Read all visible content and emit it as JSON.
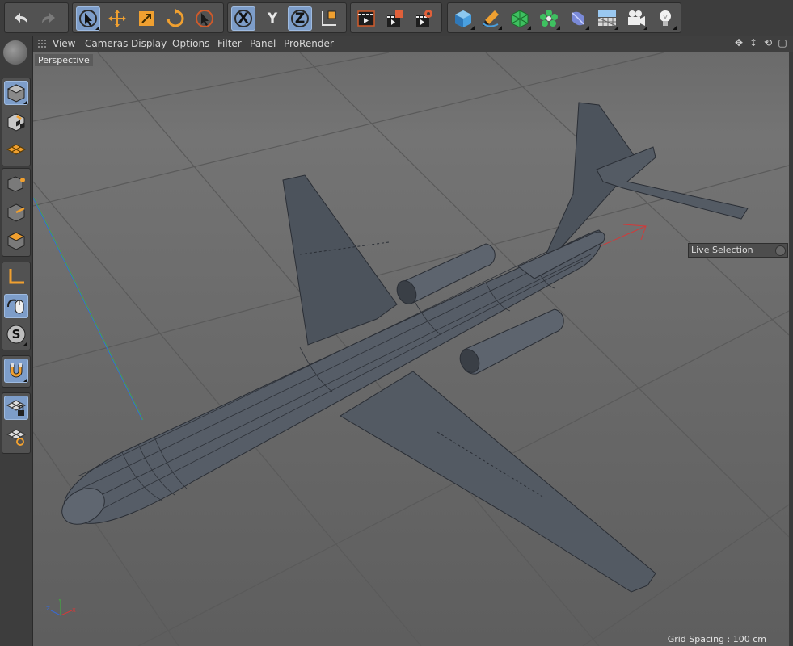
{
  "toolbar": {
    "groups": [
      {
        "name": "history",
        "buttons": [
          "undo-icon",
          "redo-icon"
        ]
      },
      {
        "name": "tools",
        "buttons": [
          "live-selection-icon",
          "move-icon",
          "scale-icon",
          "rotate-icon",
          "last-tool-icon"
        ]
      },
      {
        "name": "axis-lock",
        "buttons": [
          "x-axis-icon",
          "y-axis-icon",
          "z-axis-icon",
          "coordinate-system-icon"
        ]
      },
      {
        "name": "render",
        "buttons": [
          "render-view-icon",
          "render-picture-viewer-icon",
          "render-settings-icon"
        ]
      },
      {
        "name": "create",
        "buttons": [
          "cube-icon",
          "pen-spline-icon",
          "subdivision-icon",
          "cloner-icon",
          "deformer-icon",
          "floor-icon",
          "camera-icon",
          "light-icon"
        ]
      }
    ],
    "axis_labels": {
      "x": "X",
      "y": "Y",
      "z": "Z"
    }
  },
  "leftbar": {
    "groups": [
      {
        "name": "mode",
        "buttons": [
          "model-mode-icon",
          "texture-mode-icon",
          "workplane-mode-icon"
        ]
      },
      {
        "name": "components",
        "buttons": [
          "points-mode-icon",
          "edges-mode-icon",
          "polygons-mode-icon"
        ]
      },
      {
        "name": "axis",
        "buttons": [
          "enable-axis-icon",
          "tweak-mode-icon",
          "solo-icon"
        ]
      },
      {
        "name": "snap",
        "buttons": [
          "snap-icon"
        ]
      },
      {
        "name": "workplane",
        "buttons": [
          "lock-workplane-icon",
          "planar-workplane-icon"
        ]
      }
    ],
    "solo_letter": "S"
  },
  "menubar": {
    "items": [
      "View",
      "Cameras",
      "Display",
      "Options",
      "Filter",
      "Panel",
      "ProRender"
    ]
  },
  "viewport": {
    "camera_label": "Perspective",
    "live_selection": "Live Selection",
    "grid_spacing": "Grid Spacing : 100 cm",
    "gizmo": {
      "x": "X",
      "y": "Y",
      "z": "Z"
    }
  },
  "colors": {
    "active_button": "#7d9dc9",
    "x_axis": "#d23a3a",
    "y_axis": "#3ab83a",
    "z_axis": "#3a6ad2",
    "accent_orange": "#e89a2c"
  }
}
